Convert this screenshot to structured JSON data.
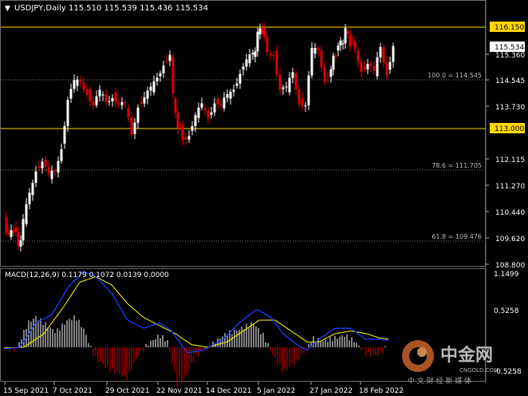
{
  "header": {
    "symbol_label": "USDJPY,Daily",
    "ohlc": "115.510 115.539 115.436 115.534"
  },
  "colors": {
    "background": "#000000",
    "bull": "#ffffff",
    "bear": "#e00000",
    "level_line": "#ffd700",
    "fib_line": "#808080",
    "macd_line": "#ffff00",
    "signal_line": "#1f3cff",
    "tag_bg": "#ffd700",
    "tag_text": "#000000"
  },
  "price_axis": {
    "ticks": [
      "116.150",
      "115.534",
      "115.360",
      "114.545",
      "113.730",
      "113.000",
      "112.115",
      "111.270",
      "110.440",
      "109.620",
      "108.800"
    ],
    "current_price": "115.534",
    "tag_113": "113.000"
  },
  "fib_levels": [
    {
      "label": "100.0 = 114.545",
      "price": 114.545
    },
    {
      "label": "78.6 = 111.705",
      "price": 111.705
    },
    {
      "label": "61.8 = 109.476",
      "price": 109.476
    }
  ],
  "levels": [
    {
      "label": "116.150",
      "price": 116.15
    },
    {
      "label": "113.000",
      "price": 113.0
    }
  ],
  "macd": {
    "title": "MACD(12,26,9) 0.1179 0.1072 0.0139 0.0000",
    "axis_top": "1.1499",
    "axis_mid": "0.5258",
    "axis_bottom": "-0.5258"
  },
  "x_axis": [
    "15 Sep 2021",
    "7 Oct 2021",
    "29 Oct 2021",
    "22 Nov 2021",
    "14 Dec 2021",
    "5 Jan 2022",
    "27 Jan 2022",
    "18 Feb 2022"
  ],
  "watermark": {
    "cn_text": "中金网",
    "sub_text": "中 文 财 经 新 媒 体",
    "url": "CNGOLD.COM"
  }
}
